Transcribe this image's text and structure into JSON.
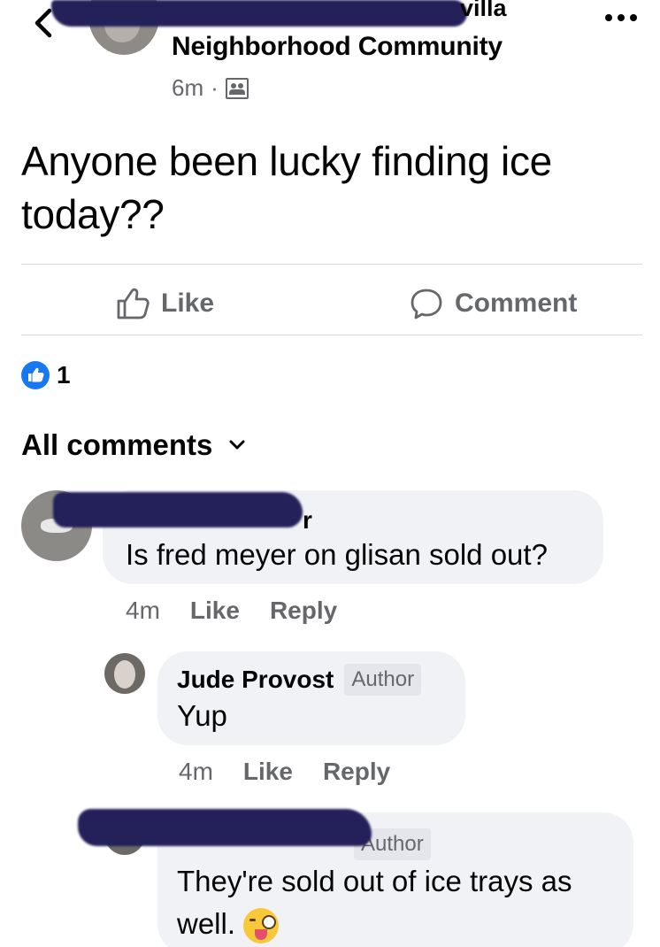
{
  "post": {
    "group_suffix": "villa",
    "group_name": "Neighborhood Community",
    "time": "6m",
    "separator": "·",
    "text": "Anyone been lucky finding ice today??",
    "actions": {
      "like_label": "Like",
      "comment_label": "Comment"
    },
    "reaction_count": "1"
  },
  "comments_header": {
    "label": "All comments"
  },
  "comments": [
    {
      "name_suffix": "r",
      "text": "Is fred meyer on glisan sold out?",
      "time": "4m",
      "like_label": "Like",
      "reply_label": "Reply"
    },
    {
      "name": "Jude Provost",
      "badge": "Author",
      "text": "Yup",
      "time": "4m",
      "like_label": "Like",
      "reply_label": "Reply"
    },
    {
      "badge": "Author",
      "text": "They're sold out of ice trays as well.",
      "emoji": "winking-face-with-tongue"
    }
  ],
  "colors": {
    "accent": "#1877f2",
    "muted": "#65676b",
    "bubble": "#f0f2f5",
    "redaction": "#23205a"
  }
}
